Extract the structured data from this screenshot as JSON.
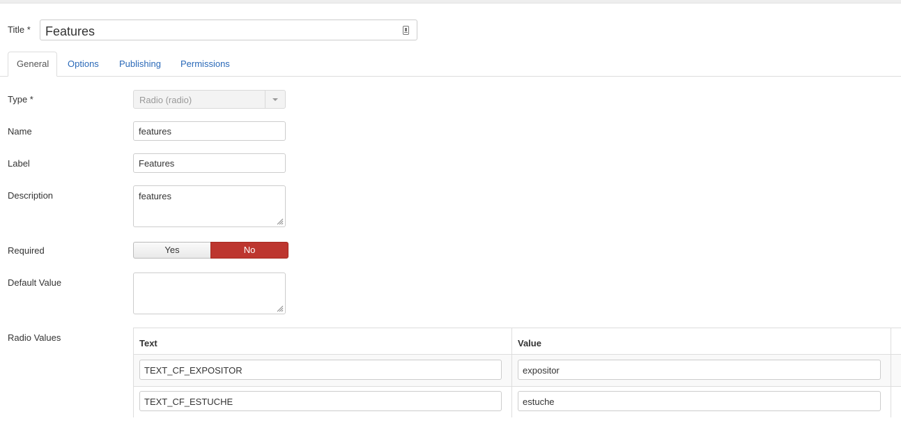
{
  "title_field": {
    "label": "Title *",
    "value": "Features",
    "icon": "lock-icon"
  },
  "tabs": [
    {
      "label": "General",
      "active": true
    },
    {
      "label": "Options",
      "active": false
    },
    {
      "label": "Publishing",
      "active": false
    },
    {
      "label": "Permissions",
      "active": false
    }
  ],
  "fields": {
    "type": {
      "label": "Type *",
      "value": "Radio (radio)"
    },
    "name": {
      "label": "Name",
      "value": "features"
    },
    "field_label": {
      "label": "Label",
      "value": "Features"
    },
    "description": {
      "label": "Description",
      "value": "features"
    },
    "required": {
      "label": "Required",
      "yes_label": "Yes",
      "no_label": "No",
      "selected": "No"
    },
    "default_value": {
      "label": "Default Value",
      "value": ""
    },
    "radio_values": {
      "label": "Radio Values",
      "columns": [
        "Text",
        "Value"
      ],
      "rows": [
        {
          "text": "TEXT_CF_EXPOSITOR",
          "value": "expositor"
        },
        {
          "text": "TEXT_CF_ESTUCHE",
          "value": "estuche"
        }
      ]
    }
  },
  "colors": {
    "link": "#2a69b8",
    "toggle_no_active": "#bd362f"
  }
}
